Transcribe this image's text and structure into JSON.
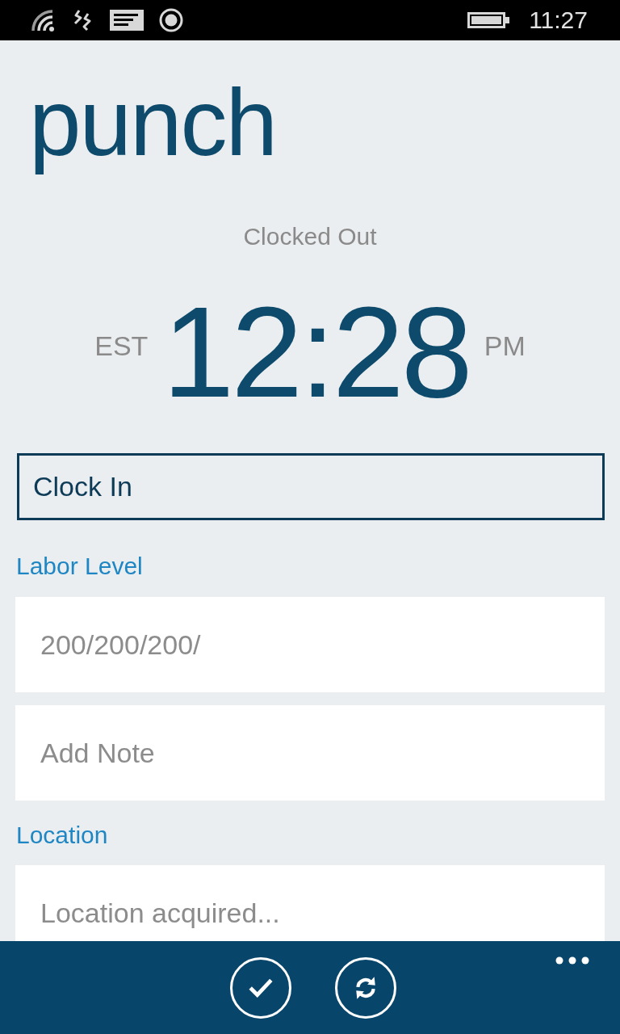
{
  "status_bar": {
    "time": "11:27"
  },
  "header": {
    "title": "punch"
  },
  "status": {
    "label": "Clocked Out"
  },
  "clock": {
    "zone": "EST",
    "time": "12:28",
    "period": "PM"
  },
  "punch_type": {
    "value": "Clock In"
  },
  "labor_level": {
    "label": "Labor Level",
    "placeholder": "200/200/200/"
  },
  "note": {
    "placeholder": "Add Note"
  },
  "location": {
    "label": "Location",
    "placeholder": "Location acquired..."
  },
  "app_bar": {
    "buttons": [
      {
        "kind": "check"
      },
      {
        "kind": "refresh"
      }
    ]
  }
}
